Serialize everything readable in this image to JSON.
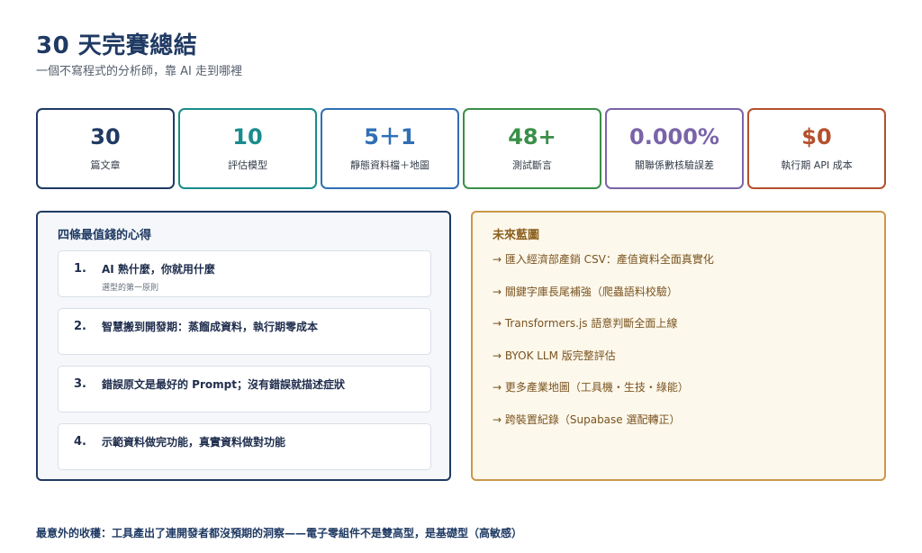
{
  "header": {
    "title": "30 天完賽總結",
    "subtitle": "一個不寫程式的分析師，靠 AI 走到哪裡"
  },
  "stats": [
    {
      "value": "30",
      "label": "篇文章",
      "color": "#1f3a63"
    },
    {
      "value": "10",
      "label": "評估模型",
      "color": "#1a8c8c"
    },
    {
      "value": "5＋1",
      "label": "靜態資料檔＋地圖",
      "color": "#2f6fb5"
    },
    {
      "value": "48+",
      "label": "測試斷言",
      "color": "#3a8f48"
    },
    {
      "value": "0.000%",
      "label": "關聯係數核驗誤差",
      "color": "#7a64a8"
    },
    {
      "value": "$0",
      "label": "執行期 API 成本",
      "color": "#b5502c"
    }
  ],
  "insights": {
    "title": "四條最值錢的心得",
    "items": [
      {
        "num": "1.",
        "text": "AI 熟什麼，你就用什麼",
        "sub": "選型的第一原則"
      },
      {
        "num": "2.",
        "text": "智慧搬到開發期：蒸餾成資料，執行期零成本",
        "sub": ""
      },
      {
        "num": "3.",
        "text": "錯誤原文是最好的 Prompt；沒有錯誤就描述症狀",
        "sub": ""
      },
      {
        "num": "4.",
        "text": "示範資料做完功能，真實資料做對功能",
        "sub": ""
      }
    ]
  },
  "roadmap": {
    "title": "未來藍圖",
    "items": [
      "→ 匯入經濟部產銷 CSV：產值資料全面真實化",
      "→ 關鍵字庫長尾補強（爬蟲語料校驗）",
      "→ Transformers.js 語意判斷全面上線",
      "→ BYOK LLM 版完整評估",
      "→ 更多產業地圖（工具機・生技・綠能）",
      "→ 跨裝置紀錄（Supabase 選配轉正）"
    ]
  },
  "footer": {
    "text": "最意外的收穫：工具產出了連開發者都沒預期的洞察——電子零組件不是雙高型，是基礎型（高敏感）"
  }
}
